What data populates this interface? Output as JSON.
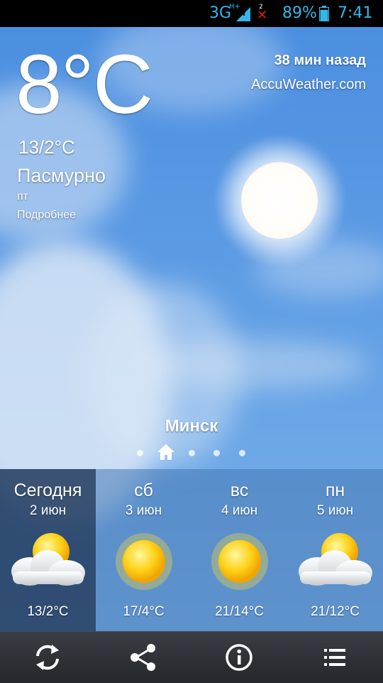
{
  "status_bar": {
    "network": "3G",
    "network_sub": "H+",
    "sim_slot": "2",
    "battery_percent": "89%",
    "battery_level": 0.89,
    "time": "7:41",
    "accent_color": "#35b6e8"
  },
  "current": {
    "temperature": "8°C",
    "range": "13/2°C",
    "condition": "Пасмурно",
    "weekday": "пт",
    "details_link": "Подробнее",
    "updated": "38 мин назад",
    "source": "AccuWeather.com",
    "city": "Минск"
  },
  "pager": {
    "pages": 5,
    "active_index": 1,
    "home_icon": "home-icon"
  },
  "forecast": [
    {
      "name": "Сегодня",
      "date": "2 июн",
      "icon": "partly-cloudy-icon",
      "temp": "13/2°C",
      "selected": true
    },
    {
      "name": "сб",
      "date": "3 июн",
      "icon": "sunny-icon",
      "temp": "17/4°C",
      "selected": false
    },
    {
      "name": "вс",
      "date": "4 июн",
      "icon": "sunny-icon",
      "temp": "21/14°C",
      "selected": false
    },
    {
      "name": "пн",
      "date": "5 июн",
      "icon": "partly-cloudy-icon",
      "temp": "21/12°C",
      "selected": false
    }
  ],
  "actions": [
    {
      "name": "refresh-icon"
    },
    {
      "name": "share-icon"
    },
    {
      "name": "info-icon"
    },
    {
      "name": "menu-list-icon"
    }
  ]
}
